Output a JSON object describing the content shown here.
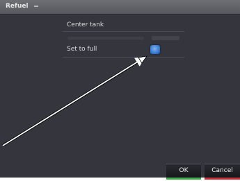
{
  "window": {
    "title": "Refuel"
  },
  "settings": {
    "tank_label": "Center tank",
    "set_to_full_label": "Set to full",
    "set_to_full_checked": true
  },
  "buttons": {
    "ok_label": "OK",
    "cancel_label": "Cancel"
  },
  "colors": {
    "background": "#34353d",
    "titlebar": "#5e6066",
    "toggle_accent": "#2f6fc8",
    "ok_accent": "#3da94a",
    "cancel_accent": "#c0303a",
    "callout_arrow": "#ffffff"
  },
  "icons": {
    "toggle": "checkbox-checked-icon",
    "callout": "callout-arrow"
  }
}
